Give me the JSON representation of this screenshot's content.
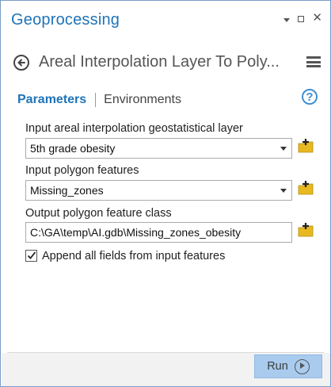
{
  "window": {
    "title": "Geoprocessing"
  },
  "tool": {
    "title": "Areal Interpolation Layer To Poly..."
  },
  "tabs": [
    {
      "label": "Parameters",
      "active": true
    },
    {
      "label": "Environments",
      "active": false
    }
  ],
  "parameters": [
    {
      "label": "Input areal interpolation geostatistical layer",
      "value": "5th grade obesity",
      "type": "dropdown"
    },
    {
      "label": "Input polygon features",
      "value": "Missing_zones",
      "type": "dropdown"
    },
    {
      "label": "Output polygon feature class",
      "value": "C:\\GA\\temp\\AI.gdb\\Missing_zones_obesity",
      "type": "text"
    }
  ],
  "append_fields": {
    "label": "Append all fields from input features",
    "checked": true
  },
  "footer": {
    "run_label": "Run"
  },
  "icons": {
    "back": "back-arrow-circle-icon",
    "menu": "hamburger-menu-icon",
    "help": "help-question-icon",
    "add": "add-data-folder-icon",
    "run": "play-circle-icon"
  },
  "colors": {
    "accent": "#1f73b7",
    "run_button": "#a9cbee",
    "folder": "#e8b820"
  }
}
